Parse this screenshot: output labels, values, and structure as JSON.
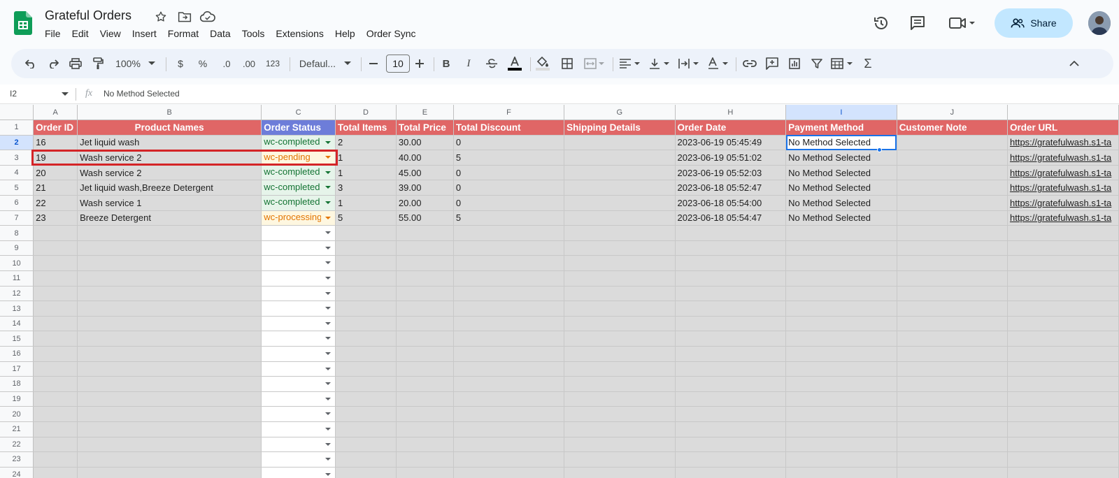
{
  "doc": {
    "title": "Grateful Orders"
  },
  "menu": [
    "File",
    "Edit",
    "View",
    "Insert",
    "Format",
    "Data",
    "Tools",
    "Extensions",
    "Help",
    "Order Sync"
  ],
  "share": {
    "label": "Share"
  },
  "toolbar": {
    "zoom": "100%",
    "currency": "$",
    "percent": "%",
    "dec_dec": ".0",
    "dec_inc": ".00",
    "format_123": "123",
    "font": "Defaul...",
    "font_size": "10",
    "bold": "B",
    "italic": "I",
    "sigma": "Σ"
  },
  "formula": {
    "cell_ref": "I2",
    "fx": "fx",
    "value": "No Method Selected"
  },
  "columns": [
    "A",
    "B",
    "C",
    "D",
    "E",
    "F",
    "G",
    "H",
    "I",
    "J",
    ""
  ],
  "header": [
    "Order ID",
    "Product Names",
    "Order Status",
    "Total Items",
    "Total Price",
    "Total Discount",
    "Shipping Details",
    "Order Date",
    "Payment Method",
    "Customer Note",
    "Order URL"
  ],
  "rows": [
    [
      "16",
      "Jet liquid wash",
      "wc-completed",
      "2",
      "30.00",
      "0",
      "",
      "2023-06-19 05:45:49",
      "No Method Selected",
      "",
      "https://gratefulwash.s1-ta"
    ],
    [
      "19",
      "Wash service 2",
      "wc-pending",
      "1",
      "40.00",
      "5",
      "",
      "2023-06-19 05:51:02",
      "No Method Selected",
      "",
      "https://gratefulwash.s1-ta"
    ],
    [
      "20",
      "Wash service 2",
      "wc-completed",
      "1",
      "45.00",
      "0",
      "",
      "2023-06-19 05:52:03",
      "No Method Selected",
      "",
      "https://gratefulwash.s1-ta"
    ],
    [
      "21",
      "Jet liquid wash,Breeze Detergent",
      "wc-completed",
      "3",
      "39.00",
      "0",
      "",
      "2023-06-18 05:52:47",
      "No Method Selected",
      "",
      "https://gratefulwash.s1-ta"
    ],
    [
      "22",
      "Wash service 1",
      "wc-completed",
      "1",
      "20.00",
      "0",
      "",
      "2023-06-18 05:54:00",
      "No Method Selected",
      "",
      "https://gratefulwash.s1-ta"
    ],
    [
      "23",
      "Breeze Detergent",
      "wc-processing",
      "5",
      "55.00",
      "5",
      "",
      "2023-06-18 05:54:47",
      "No Method Selected",
      "",
      "https://gratefulwash.s1-ta"
    ]
  ],
  "row_numbers": [
    "1",
    "2",
    "3",
    "4",
    "5",
    "6",
    "7",
    "8",
    "9",
    "10",
    "11",
    "12",
    "13",
    "14",
    "15",
    "16",
    "17",
    "18",
    "19",
    "20",
    "21",
    "22",
    "23",
    "24"
  ],
  "colors": {
    "header_red": "#e06666",
    "header_status": "#6d7dd9",
    "accent": "#1a73e8",
    "highlight_box": "#d42427",
    "completed": "#137333",
    "pending": "#e37400"
  },
  "selection": {
    "active_cell": "I2",
    "highlighted_row": "3"
  }
}
